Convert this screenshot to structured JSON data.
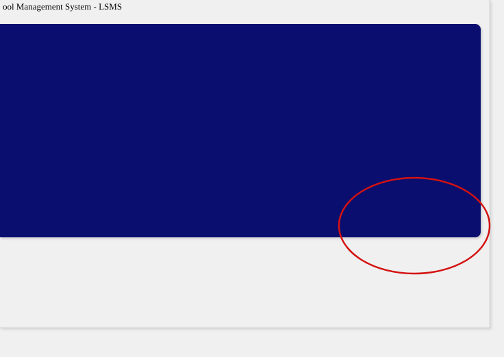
{
  "window": {
    "title": "ool Management System - LSMS"
  }
}
